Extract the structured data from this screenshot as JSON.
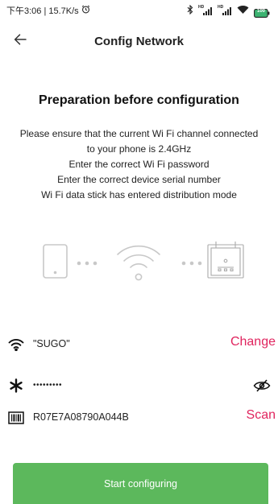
{
  "status": {
    "left_text": "下午3:06 | 15.7K/s",
    "signal_label_1": "HD",
    "signal_label_2": "HD",
    "battery_level": "100"
  },
  "header": {
    "title": "Config Network"
  },
  "preparation": {
    "title": "Preparation before configuration",
    "lines": [
      "Please ensure that the current Wi Fi channel connected",
      "to your phone is 2.4GHz",
      "Enter the correct Wi Fi password",
      "Enter the correct device serial number",
      "Wi Fi data stick has entered distribution mode"
    ]
  },
  "wifi": {
    "ssid": "\"SUGO\"",
    "change_label": "Change"
  },
  "password": {
    "masked_value": "•••••••••"
  },
  "serial": {
    "value": "R07E7A08790A044B",
    "scan_label": "Scan"
  },
  "start_button": {
    "label": "Start configuring"
  },
  "colors": {
    "accent_pink": "#e0245e",
    "button_green": "#5cb85c",
    "illustration_gray": "#c8c8c8"
  }
}
